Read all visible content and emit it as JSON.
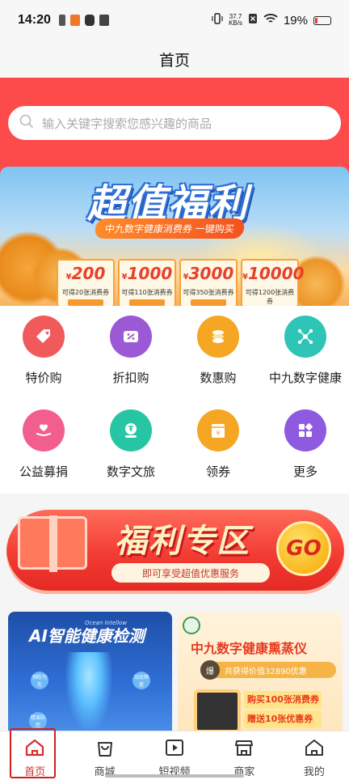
{
  "status_bar": {
    "time": "14:20",
    "speed_value": "37.7",
    "speed_unit": "KB/s",
    "battery": "19%",
    "battery_level": 0.19
  },
  "header": {
    "title": "首页"
  },
  "search": {
    "placeholder": "输入关键字搜索您感兴趣的商品",
    "icon": "search-icon"
  },
  "banner": {
    "title": "超值福利",
    "subtitle": "中九数字健康消费券 一键购买",
    "vouchers": [
      {
        "currency": "¥",
        "amount": "200",
        "desc": "可得20张消费券"
      },
      {
        "currency": "¥",
        "amount": "1000",
        "desc": "可得110张消费券"
      },
      {
        "currency": "¥",
        "amount": "3000",
        "desc": "可得350张消费券"
      },
      {
        "currency": "¥",
        "amount": "10000",
        "desc": "可得1200张消费券"
      }
    ]
  },
  "categories": [
    {
      "label": "特价购",
      "icon": "tag-icon",
      "color": "#f15a5a"
    },
    {
      "label": "折扣购",
      "icon": "discount-ticket-icon",
      "color": "#9b59d6"
    },
    {
      "label": "数惠购",
      "icon": "coins-icon",
      "color": "#f5a623"
    },
    {
      "label": "中九数字健康",
      "icon": "network-icon",
      "color": "#2ec4b6"
    },
    {
      "label": "公益募捐",
      "icon": "heart-hand-icon",
      "color": "#f25f8f"
    },
    {
      "label": "数字文旅",
      "icon": "travel-coin-icon",
      "color": "#26c6a4"
    },
    {
      "label": "领券",
      "icon": "coupon-icon",
      "color": "#f5a623"
    },
    {
      "label": "更多",
      "icon": "more-grid-icon",
      "color": "#8e5be0"
    }
  ],
  "promo_zone": {
    "title": "福利专区",
    "tagline": "即可享受超值优惠服务",
    "go_label": "GO"
  },
  "cards": {
    "ai": {
      "title": "AI智能健康检测",
      "small_text": "Ocean Intellow",
      "badges": [
        "预防为先",
        "动态筛查",
        "精准防控"
      ]
    },
    "device": {
      "title": "中九数字健康熏蒸仪",
      "badge": "爆",
      "price_line": "共获得价值32890优惠",
      "promo_lines": [
        "购买100张消费券",
        "赠送10张优惠券"
      ]
    }
  },
  "tabbar": {
    "active": "首页",
    "items": [
      {
        "label": "首页",
        "icon": "home-icon"
      },
      {
        "label": "商城",
        "icon": "shopping-bag-icon"
      },
      {
        "label": "短视频",
        "icon": "video-play-icon"
      },
      {
        "label": "商家",
        "icon": "store-icon"
      },
      {
        "label": "我的",
        "icon": "user-home-icon"
      }
    ]
  }
}
